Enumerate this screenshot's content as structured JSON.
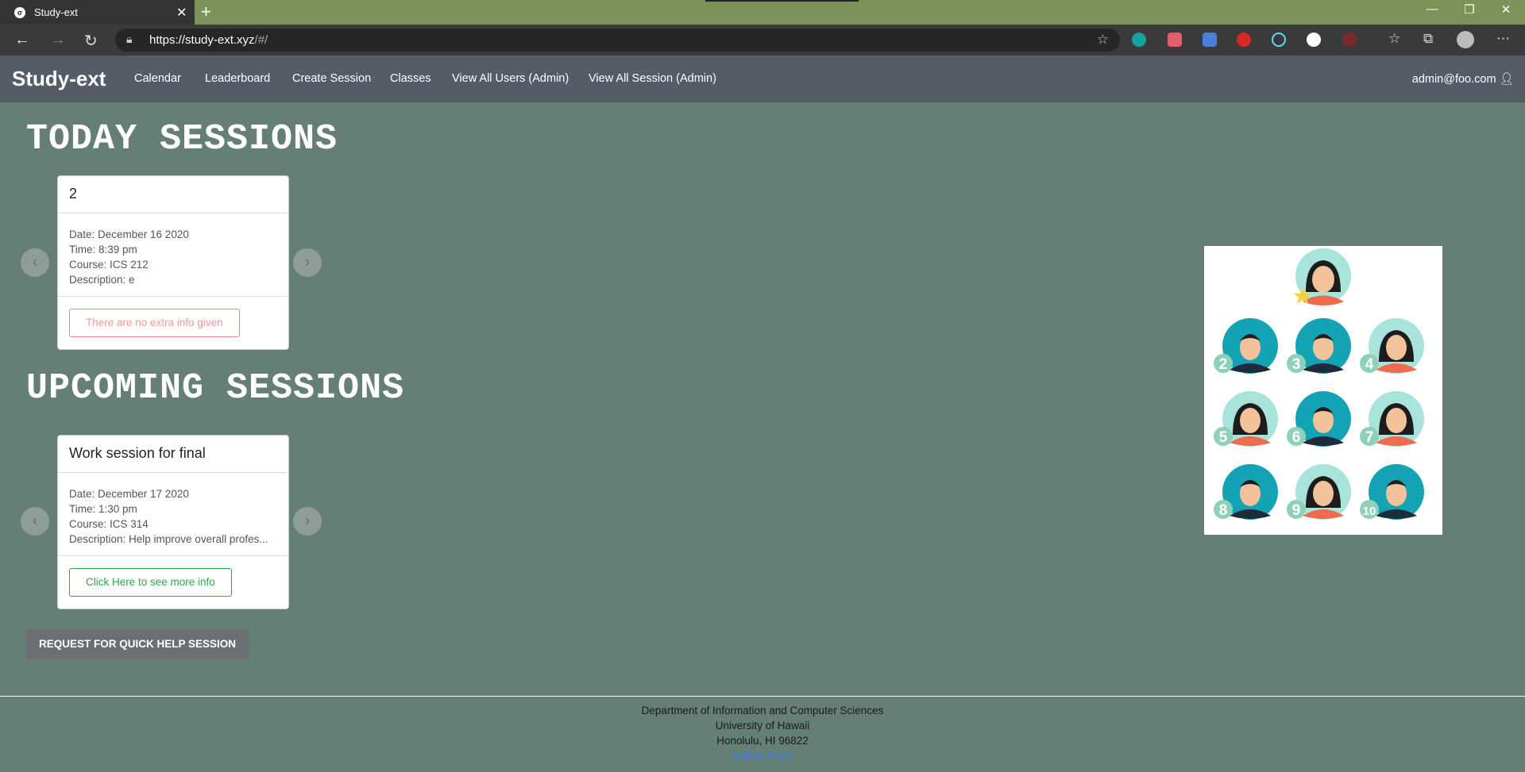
{
  "browser": {
    "tab_title": "Study-ext",
    "favicon": "study-ext-favicon",
    "url_main": "https://study-ext.xyz",
    "url_dim": "/#/"
  },
  "nav": {
    "brand": "Study-ext",
    "links": [
      "Calendar",
      "Leaderboard",
      "Create Session",
      "Classes",
      "View All Users (Admin)",
      "View All Session (Admin)"
    ],
    "user": "admin@foo.com"
  },
  "today": {
    "heading": "TODAY SESSIONS",
    "card": {
      "title": "2",
      "date": "Date: December 16 2020",
      "time": "Time: 8:39 pm",
      "course": "Course: ICS 212",
      "description": "Description: e",
      "button": "There are no extra info given"
    }
  },
  "upcoming": {
    "heading": "UPCOMING SESSIONS",
    "card": {
      "title": "Work session for final",
      "date": "Date: December 17 2020",
      "time": "Time: 1:30 pm",
      "course": "Course: ICS 314",
      "description": "Description: Help improve overall profes...",
      "button": "Click Here to see more info"
    }
  },
  "quick_help": "REQUEST FOR QUICK HELP SESSION",
  "avatars": {
    "numbers": [
      "2",
      "3",
      "4",
      "5",
      "6",
      "7",
      "8",
      "9",
      "10"
    ]
  },
  "footer": {
    "line1": "Department of Information and Computer Sciences",
    "line2": "University of Hawaii",
    "line3": "Honolulu, HI 96822",
    "link": "GitHub Page"
  },
  "colors": {
    "background": "#667f74",
    "navbar": "#545c68",
    "accent_green": "#2ba84a"
  }
}
